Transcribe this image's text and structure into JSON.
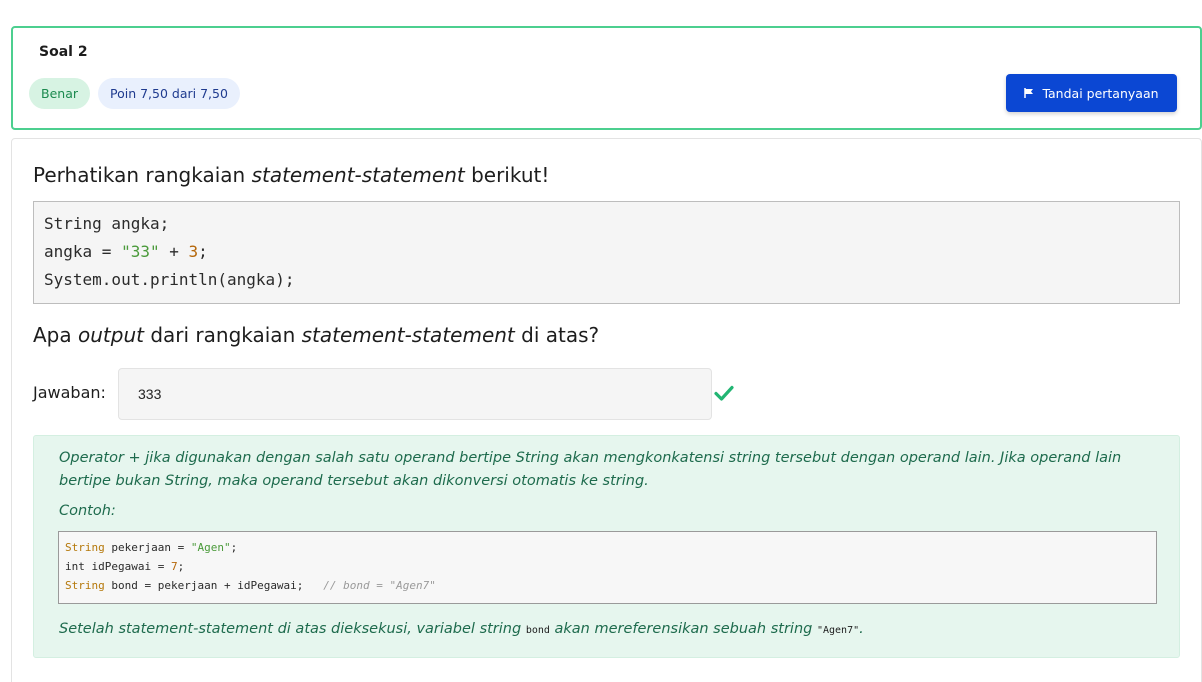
{
  "question": {
    "title": "Soal 2",
    "status_badge": "Benar",
    "points_badge": "Poin 7,50 dari 7,50",
    "flag_button": "Tandai pertanyaan"
  },
  "prompt1": {
    "before": "Perhatikan rangkaian ",
    "em": "statement-statement",
    "after": " berikut!"
  },
  "code": {
    "line1": "String angka;",
    "line2_a": "angka = ",
    "line2_str": "\"33\"",
    "line2_b": " + ",
    "line2_num": "3",
    "line2_c": ";",
    "line3": "System.out.println(angka);"
  },
  "prompt2": {
    "before": "Apa ",
    "em1": "output",
    "mid": " dari rangkaian ",
    "em2": "statement-statement",
    "after": " di atas?"
  },
  "answer": {
    "label": "Jawaban:",
    "value": "333"
  },
  "feedback": {
    "text1": "Operator + jika digunakan dengan salah satu operand bertipe String akan mengkonkatensi string tersebut dengan operand lain. Jika operand lain bertipe bukan String, maka operand tersebut akan dikonversi otomatis ke string.",
    "text2": "Contoh:",
    "code1_kw": "String",
    "code1_a": " pekerjaan = ",
    "code1_str": "\"Agen\"",
    "code1_b": ";",
    "code2_a": "int idPegawai = ",
    "code2_num": "7",
    "code2_b": ";",
    "code3_kw": "String",
    "code3_a": " bond = pekerjaan + idPegawai;   ",
    "code3_comment": "// bond = \"Agen7\"",
    "text3_a": "Setelah statement-statement di atas dieksekusi, variabel string ",
    "text3_code1": "bond",
    "text3_b": " akan mereferensikan sebuah string ",
    "text3_code2": "\"Agen7\"",
    "text3_c": "."
  },
  "colors": {
    "accent": "#0b47d3",
    "correct": "#22b573",
    "border_correct": "#4ccf8f",
    "feedback_bg": "#e6f6ee"
  },
  "icons": {
    "flag": "flag-icon",
    "check": "check-icon"
  }
}
